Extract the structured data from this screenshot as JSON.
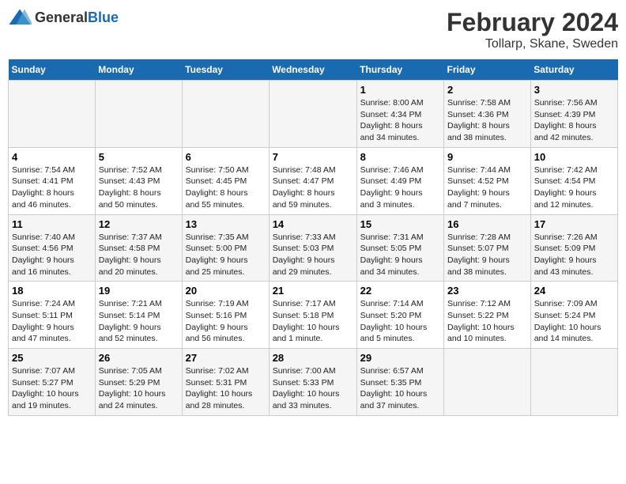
{
  "logo": {
    "text_general": "General",
    "text_blue": "Blue"
  },
  "title": {
    "main": "February 2024",
    "sub": "Tollarp, Skane, Sweden"
  },
  "calendar": {
    "headers": [
      "Sunday",
      "Monday",
      "Tuesday",
      "Wednesday",
      "Thursday",
      "Friday",
      "Saturday"
    ],
    "weeks": [
      [
        {
          "day": "",
          "info": ""
        },
        {
          "day": "",
          "info": ""
        },
        {
          "day": "",
          "info": ""
        },
        {
          "day": "",
          "info": ""
        },
        {
          "day": "1",
          "info": "Sunrise: 8:00 AM\nSunset: 4:34 PM\nDaylight: 8 hours\nand 34 minutes."
        },
        {
          "day": "2",
          "info": "Sunrise: 7:58 AM\nSunset: 4:36 PM\nDaylight: 8 hours\nand 38 minutes."
        },
        {
          "day": "3",
          "info": "Sunrise: 7:56 AM\nSunset: 4:39 PM\nDaylight: 8 hours\nand 42 minutes."
        }
      ],
      [
        {
          "day": "4",
          "info": "Sunrise: 7:54 AM\nSunset: 4:41 PM\nDaylight: 8 hours\nand 46 minutes."
        },
        {
          "day": "5",
          "info": "Sunrise: 7:52 AM\nSunset: 4:43 PM\nDaylight: 8 hours\nand 50 minutes."
        },
        {
          "day": "6",
          "info": "Sunrise: 7:50 AM\nSunset: 4:45 PM\nDaylight: 8 hours\nand 55 minutes."
        },
        {
          "day": "7",
          "info": "Sunrise: 7:48 AM\nSunset: 4:47 PM\nDaylight: 8 hours\nand 59 minutes."
        },
        {
          "day": "8",
          "info": "Sunrise: 7:46 AM\nSunset: 4:49 PM\nDaylight: 9 hours\nand 3 minutes."
        },
        {
          "day": "9",
          "info": "Sunrise: 7:44 AM\nSunset: 4:52 PM\nDaylight: 9 hours\nand 7 minutes."
        },
        {
          "day": "10",
          "info": "Sunrise: 7:42 AM\nSunset: 4:54 PM\nDaylight: 9 hours\nand 12 minutes."
        }
      ],
      [
        {
          "day": "11",
          "info": "Sunrise: 7:40 AM\nSunset: 4:56 PM\nDaylight: 9 hours\nand 16 minutes."
        },
        {
          "day": "12",
          "info": "Sunrise: 7:37 AM\nSunset: 4:58 PM\nDaylight: 9 hours\nand 20 minutes."
        },
        {
          "day": "13",
          "info": "Sunrise: 7:35 AM\nSunset: 5:00 PM\nDaylight: 9 hours\nand 25 minutes."
        },
        {
          "day": "14",
          "info": "Sunrise: 7:33 AM\nSunset: 5:03 PM\nDaylight: 9 hours\nand 29 minutes."
        },
        {
          "day": "15",
          "info": "Sunrise: 7:31 AM\nSunset: 5:05 PM\nDaylight: 9 hours\nand 34 minutes."
        },
        {
          "day": "16",
          "info": "Sunrise: 7:28 AM\nSunset: 5:07 PM\nDaylight: 9 hours\nand 38 minutes."
        },
        {
          "day": "17",
          "info": "Sunrise: 7:26 AM\nSunset: 5:09 PM\nDaylight: 9 hours\nand 43 minutes."
        }
      ],
      [
        {
          "day": "18",
          "info": "Sunrise: 7:24 AM\nSunset: 5:11 PM\nDaylight: 9 hours\nand 47 minutes."
        },
        {
          "day": "19",
          "info": "Sunrise: 7:21 AM\nSunset: 5:14 PM\nDaylight: 9 hours\nand 52 minutes."
        },
        {
          "day": "20",
          "info": "Sunrise: 7:19 AM\nSunset: 5:16 PM\nDaylight: 9 hours\nand 56 minutes."
        },
        {
          "day": "21",
          "info": "Sunrise: 7:17 AM\nSunset: 5:18 PM\nDaylight: 10 hours\nand 1 minute."
        },
        {
          "day": "22",
          "info": "Sunrise: 7:14 AM\nSunset: 5:20 PM\nDaylight: 10 hours\nand 5 minutes."
        },
        {
          "day": "23",
          "info": "Sunrise: 7:12 AM\nSunset: 5:22 PM\nDaylight: 10 hours\nand 10 minutes."
        },
        {
          "day": "24",
          "info": "Sunrise: 7:09 AM\nSunset: 5:24 PM\nDaylight: 10 hours\nand 14 minutes."
        }
      ],
      [
        {
          "day": "25",
          "info": "Sunrise: 7:07 AM\nSunset: 5:27 PM\nDaylight: 10 hours\nand 19 minutes."
        },
        {
          "day": "26",
          "info": "Sunrise: 7:05 AM\nSunset: 5:29 PM\nDaylight: 10 hours\nand 24 minutes."
        },
        {
          "day": "27",
          "info": "Sunrise: 7:02 AM\nSunset: 5:31 PM\nDaylight: 10 hours\nand 28 minutes."
        },
        {
          "day": "28",
          "info": "Sunrise: 7:00 AM\nSunset: 5:33 PM\nDaylight: 10 hours\nand 33 minutes."
        },
        {
          "day": "29",
          "info": "Sunrise: 6:57 AM\nSunset: 5:35 PM\nDaylight: 10 hours\nand 37 minutes."
        },
        {
          "day": "",
          "info": ""
        },
        {
          "day": "",
          "info": ""
        }
      ]
    ]
  }
}
